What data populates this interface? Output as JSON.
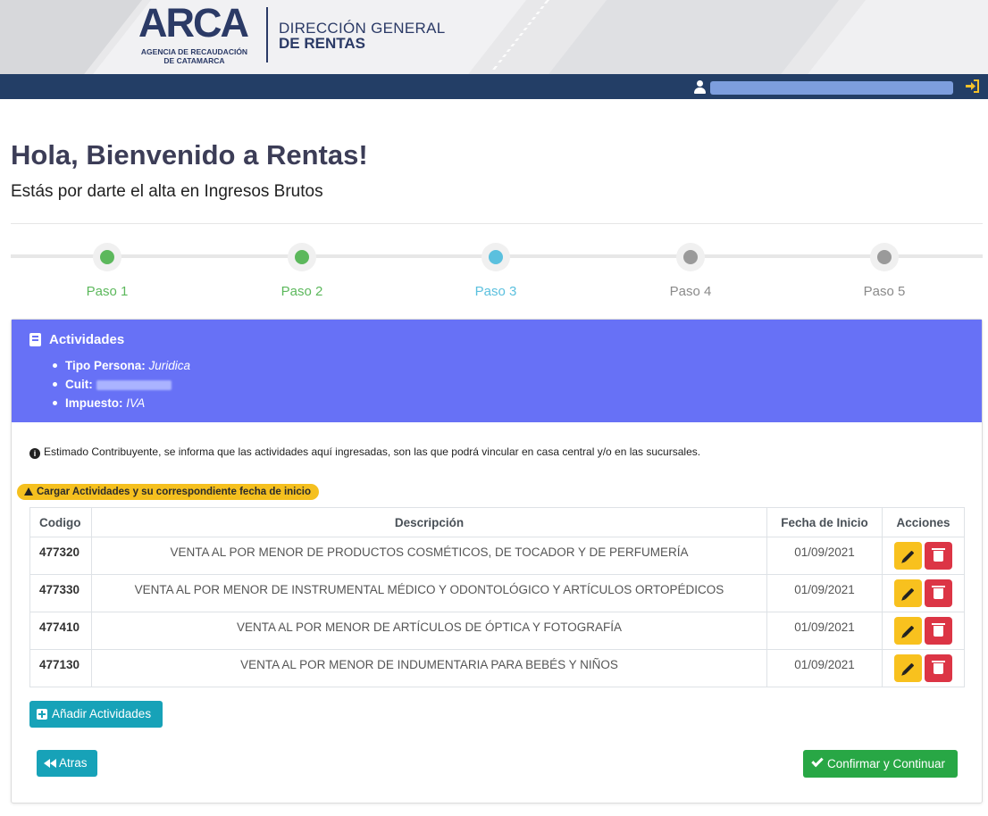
{
  "header": {
    "logo_word": "ARCA",
    "logo_sub1": "AGENCIA DE RECAUDACIÓN",
    "logo_sub2": "DE CATAMARCA",
    "org_line1": "DIRECCIÓN GENERAL",
    "org_line2": "DE RENTAS"
  },
  "navbar": {
    "user_icon": "user-icon",
    "logout_icon": "sign-in-icon"
  },
  "page": {
    "title": "Hola, Bienvenido a Rentas!",
    "subtitle": "Estás por darte el alta en Ingresos Brutos"
  },
  "stepper": {
    "steps": [
      {
        "label": "Paso 1",
        "state": "done",
        "color": "#5cb85c"
      },
      {
        "label": "Paso 2",
        "state": "done",
        "color": "#5cb85c"
      },
      {
        "label": "Paso 3",
        "state": "current",
        "color": "#5bc0de"
      },
      {
        "label": "Paso 4",
        "state": "pending",
        "color": "#9a9a9a"
      },
      {
        "label": "Paso 5",
        "state": "pending",
        "color": "#9a9a9a"
      }
    ]
  },
  "card": {
    "title": "Actividades",
    "header_color": "#6771f6",
    "info": {
      "tipo_label": "Tipo Persona:",
      "tipo_value": "Juridica",
      "cuit_label": "Cuit:",
      "impuesto_label": "Impuesto:",
      "impuesto_value": "IVA"
    },
    "notice": "Estimado Contribuyente, se informa que las actividades aquí ingresadas, son las que podrá vincular en casa central y/o en las sucursales.",
    "warning": "Cargar Actividades y su correspondiente fecha de inicio"
  },
  "table": {
    "headers": {
      "code": "Codigo",
      "desc": "Descripción",
      "date": "Fecha de Inicio",
      "actions": "Acciones"
    },
    "rows": [
      {
        "code": "477320",
        "desc": "VENTA AL POR MENOR DE PRODUCTOS COSMÉTICOS, DE TOCADOR Y DE PERFUMERÍA",
        "date": "01/09/2021"
      },
      {
        "code": "477330",
        "desc": "VENTA AL POR MENOR DE INSTRUMENTAL MÉDICO Y ODONTOLÓGICO Y ARTÍCULOS ORTOPÉDICOS",
        "date": "01/09/2021"
      },
      {
        "code": "477410",
        "desc": "VENTA AL POR MENOR DE ARTÍCULOS DE ÓPTICA Y FOTOGRAFÍA",
        "date": "01/09/2021"
      },
      {
        "code": "477130",
        "desc": "VENTA AL POR MENOR DE INDUMENTARIA PARA BEBÉS Y NIÑOS",
        "date": "01/09/2021"
      }
    ]
  },
  "buttons": {
    "add": "Añadir Actividades",
    "back": "Atras",
    "confirm": "Confirmar y Continuar"
  }
}
